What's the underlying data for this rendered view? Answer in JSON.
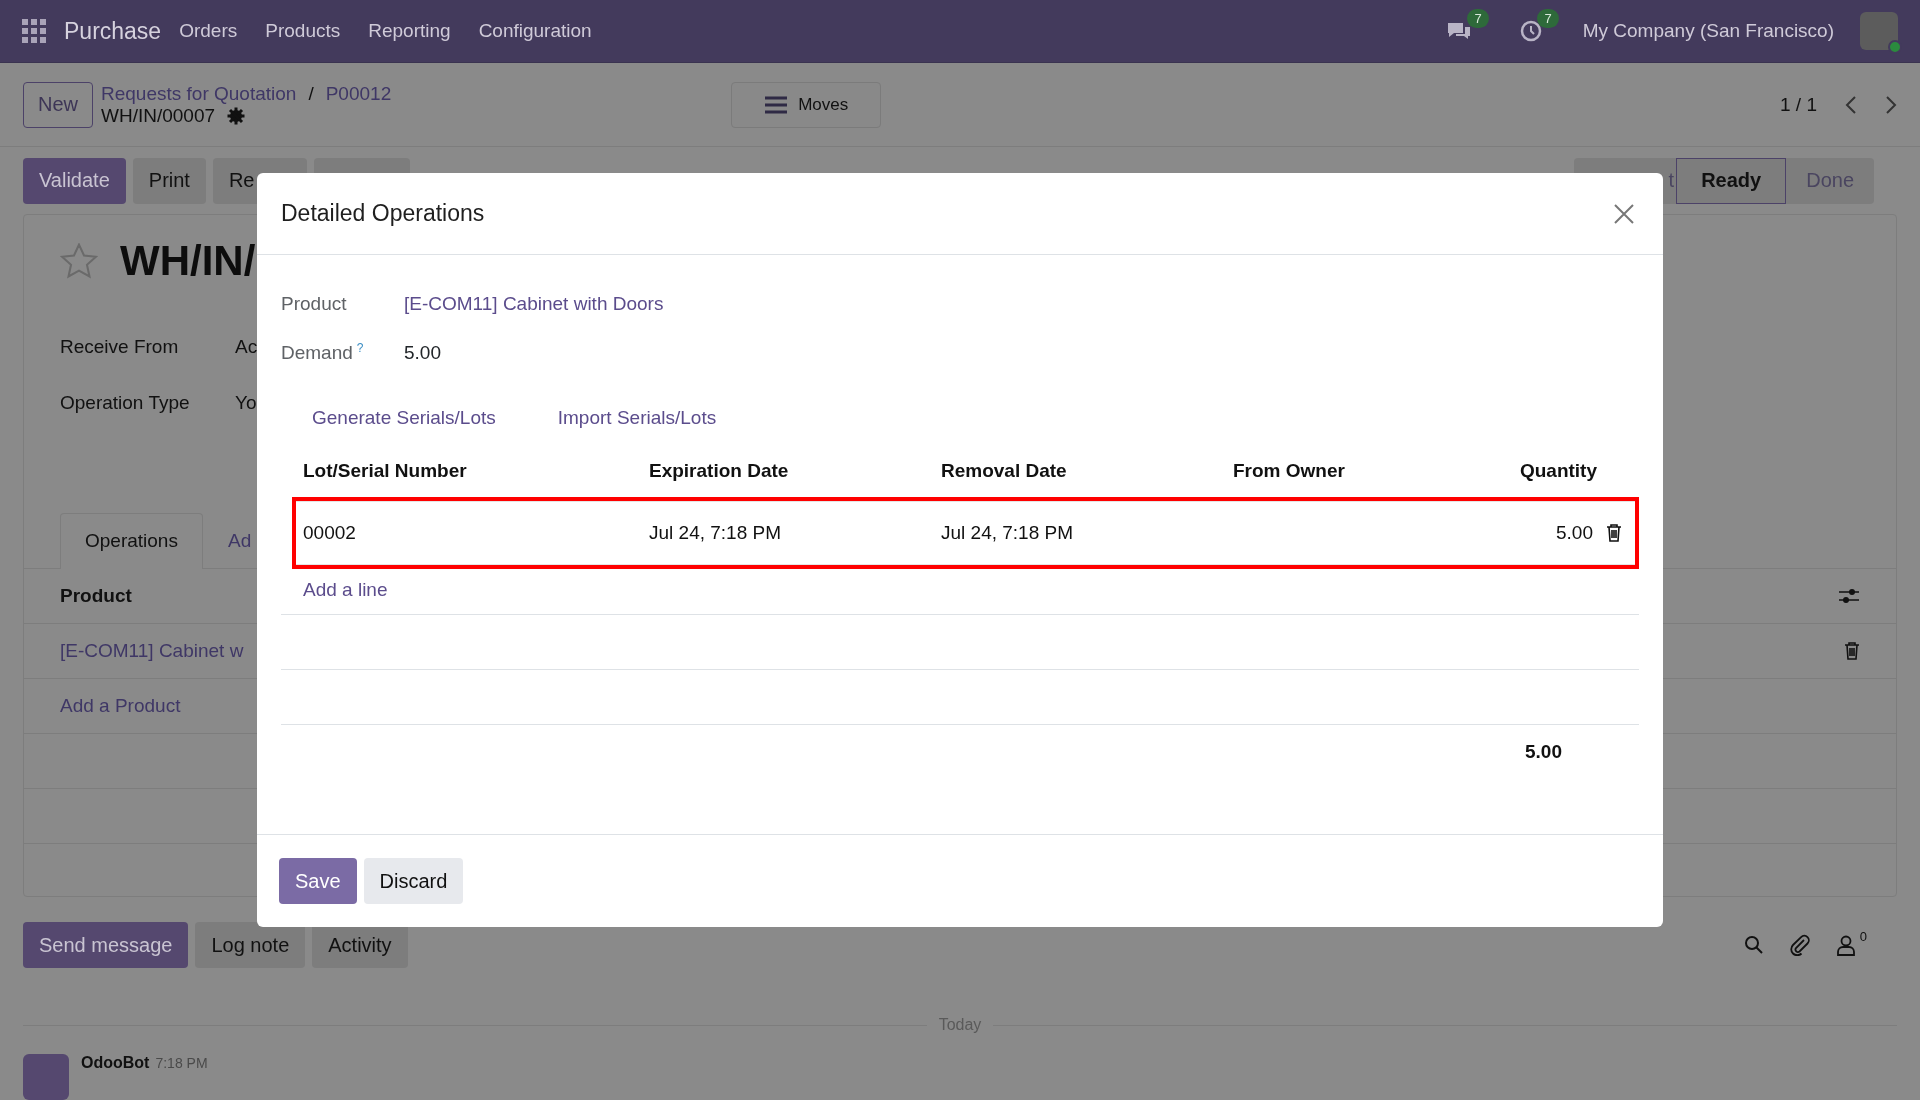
{
  "navbar": {
    "app": "Purchase",
    "menu": [
      "Orders",
      "Products",
      "Reporting",
      "Configuration"
    ],
    "messages_badge": "7",
    "activities_badge": "7",
    "company": "My Company (San Francisco)"
  },
  "control_panel": {
    "new_button": "New",
    "breadcrumbs": [
      "Requests for Quotation",
      "P00012"
    ],
    "separator": "/",
    "record": "WH/IN/00007",
    "moves_button": "Moves",
    "pager": "1 / 1"
  },
  "actions": [
    {
      "kind": "primary",
      "label": "Validate"
    },
    {
      "kind": "secondary",
      "label": "Print"
    },
    {
      "kind": "secondary",
      "label": "Re"
    },
    {
      "kind": "blank"
    }
  ],
  "status_stages": [
    {
      "label": "t",
      "selected": false
    },
    {
      "label": "Ready",
      "selected": true
    },
    {
      "label": "Done",
      "selected": false
    }
  ],
  "form": {
    "title": "WH/IN/",
    "starred": false,
    "fields": [
      {
        "label": "Receive From",
        "value": "Ac"
      },
      {
        "label": "Operation Type",
        "value": "Yo"
      }
    ],
    "tabs": [
      {
        "label": "Operations",
        "selected": true
      },
      {
        "label": "Ad",
        "selected": false
      }
    ],
    "table_header": "Product",
    "rows": [
      "[E-COM11] Cabinet w"
    ],
    "add_link": "Add a Product"
  },
  "chatter": {
    "buttons": [
      "Send message",
      "Log note",
      "Activity"
    ],
    "followers": "0",
    "divider": "Today",
    "message_author": "OdooBot",
    "message_time": "7:18 PM"
  },
  "dialog": {
    "title": "Detailed Operations",
    "product_label": "Product",
    "product": "[E-COM11] Cabinet with Doors",
    "demand_label": "Demand",
    "demand_help": "?",
    "demand": "5.00",
    "links": [
      "Generate Serials/Lots",
      "Import Serials/Lots"
    ],
    "columns": [
      "Lot/Serial Number",
      "Expiration Date",
      "Removal Date",
      "From Owner",
      "Quantity"
    ],
    "rows": [
      {
        "lot": "00002",
        "expiration": "Jul 24, 7:18 PM",
        "removal": "Jul 24, 7:18 PM",
        "quantity": "5.00",
        "highlighted": true
      }
    ],
    "add_line": "Add a line",
    "total": "5.00",
    "buttons": [
      "Save",
      "Discard"
    ]
  }
}
